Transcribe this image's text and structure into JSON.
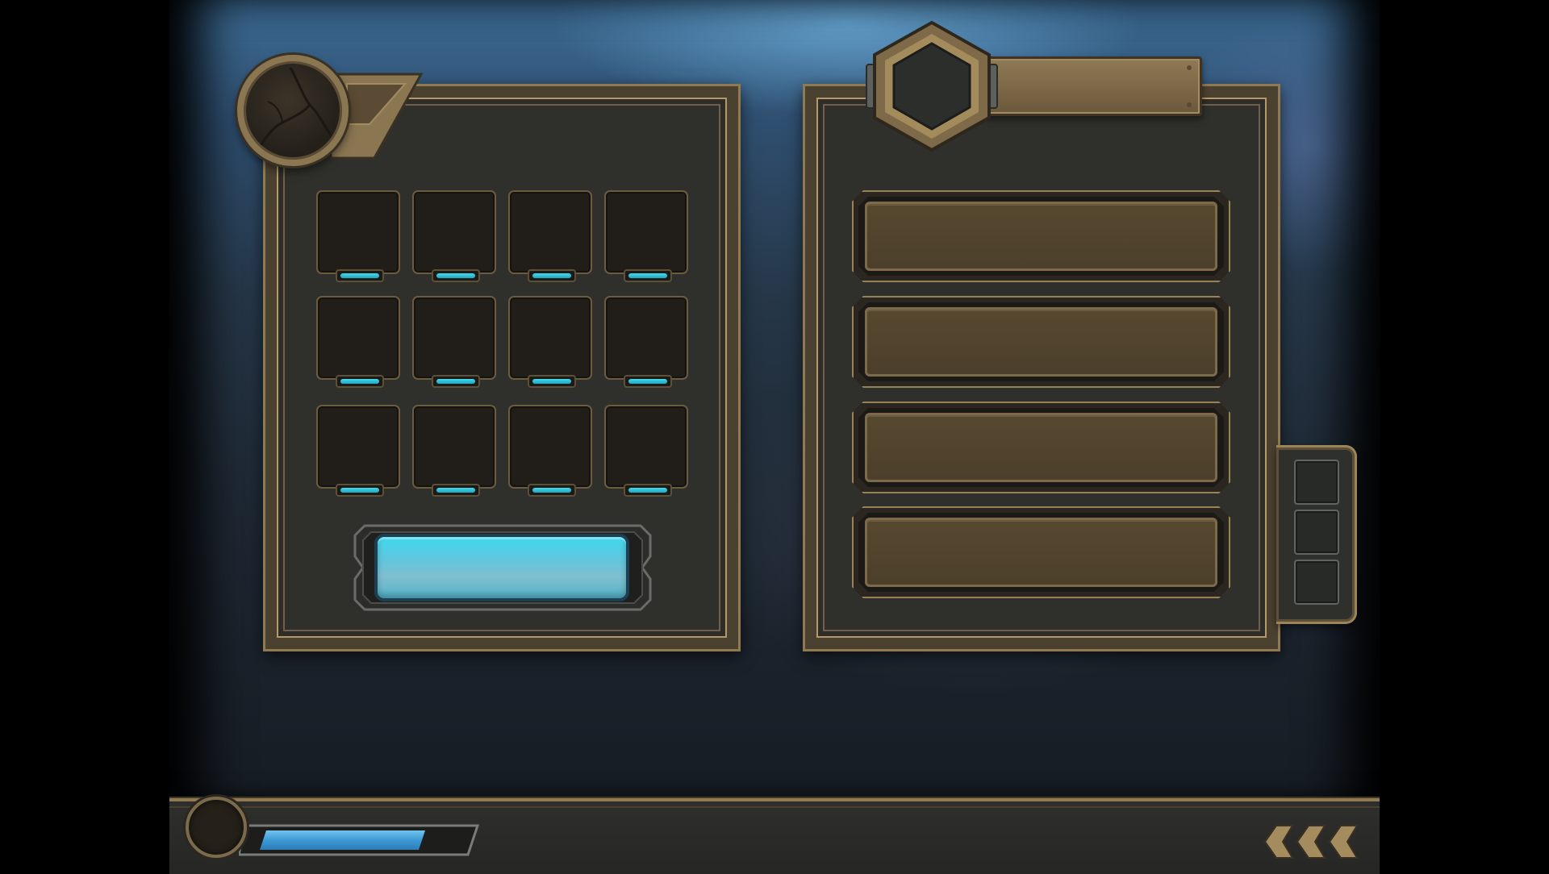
{
  "screen": {
    "name": "game-menu-mockup",
    "colors": {
      "bronze": "#8f7a52",
      "panel_dark": "#2f2f2b",
      "accent_cyan": "#3fd9ee",
      "xp_blue": "#3a96d2"
    }
  },
  "left_panel": {
    "emblem_icon": "cracked-orb-icon",
    "grid": {
      "rows": 3,
      "cols": 4
    },
    "slots": [
      {
        "icon": "empty"
      },
      {
        "icon": "empty"
      },
      {
        "icon": "empty"
      },
      {
        "icon": "empty"
      },
      {
        "icon": "empty"
      },
      {
        "icon": "empty"
      },
      {
        "icon": "empty"
      },
      {
        "icon": "empty"
      },
      {
        "icon": "empty"
      },
      {
        "icon": "empty"
      },
      {
        "icon": "empty"
      },
      {
        "icon": "empty"
      }
    ],
    "primary_button_label": ""
  },
  "right_panel": {
    "badge_icon": "hexagon-badge-icon",
    "name_plate_text": "",
    "rows": [
      {
        "label": ""
      },
      {
        "label": ""
      },
      {
        "label": ""
      },
      {
        "label": ""
      }
    ],
    "side_tabs": [
      {
        "icon": "empty"
      },
      {
        "icon": "empty"
      },
      {
        "icon": "empty"
      }
    ]
  },
  "bottom_bar": {
    "avatar_icon": "avatar-icon",
    "xp_progress": 0.76,
    "back_icon": "triple-chevron-left-icon"
  }
}
